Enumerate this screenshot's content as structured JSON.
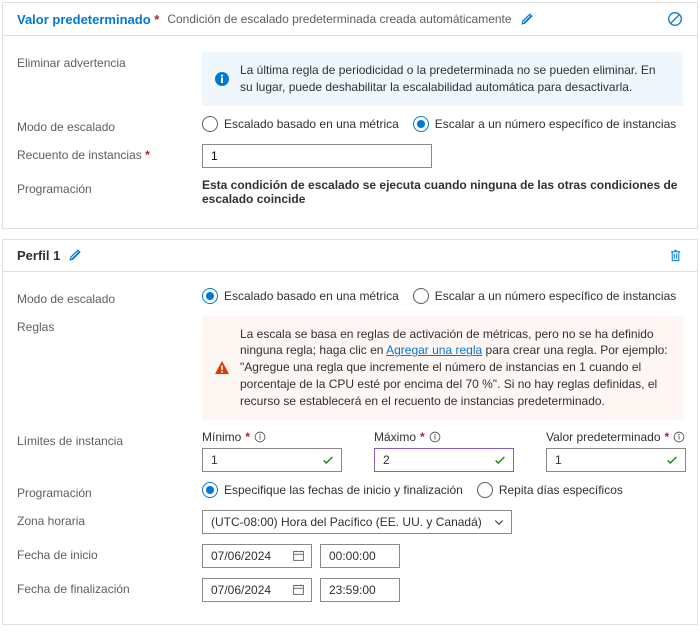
{
  "card1": {
    "title": "Valor predeterminado",
    "subtitle": "Condición de escalado predeterminada creada automáticamente",
    "warning_label": "Eliminar advertencia",
    "warning_text": "La última regla de periodicidad o la predeterminada no se pueden eliminar. En su lugar, puede deshabilitar la escalabilidad automática para desactivarla.",
    "scale_mode_label": "Modo de escalado",
    "scale_mode_metric": "Escalado basado en una métrica",
    "scale_mode_count": "Escalar a un número específico de instancias",
    "instance_count_label": "Recuento de instancias",
    "instance_count_value": "1",
    "schedule_label": "Programación",
    "schedule_text": "Esta condición de escalado se ejecuta cuando ninguna de las otras condiciones de escalado coincide"
  },
  "card2": {
    "title": "Perfil 1",
    "scale_mode_label": "Modo de escalado",
    "scale_mode_metric": "Escalado basado en una métrica",
    "scale_mode_count": "Escalar a un número específico de instancias",
    "rules_label": "Reglas",
    "rules_text_a": "La escala se basa en reglas de activación de métricas, pero no se ha definido ninguna regla; haga clic en ",
    "rules_link": "Agregar una regla",
    "rules_text_b": " para crear una regla. Por ejemplo: \"Agregue una regla que incremente el número de instancias en 1 cuando el porcentaje de la CPU esté por encima del 70 %\". Si no hay reglas definidas, el recurso se establecerá en el recuento de instancias predeterminado.",
    "limits_label": "Límites de instancia",
    "limits": {
      "min_label": "Mínimo",
      "min_value": "1",
      "max_label": "Máximo",
      "max_value": "2",
      "def_label": "Valor predeterminado",
      "def_value": "1"
    },
    "schedule_label": "Programación",
    "schedule_opt_range": "Especifique las fechas de inicio y finalización",
    "schedule_opt_repeat": "Repita días específicos",
    "timezone_label": "Zona horaria",
    "timezone_value": "(UTC-08:00) Hora del Pacífico (EE. UU. y Canadá)",
    "start_label": "Fecha de inicio",
    "start_date": "07/06/2024",
    "start_time": "00:00:00",
    "end_label": "Fecha de finalización",
    "end_date": "07/06/2024",
    "end_time": "23:59:00"
  }
}
